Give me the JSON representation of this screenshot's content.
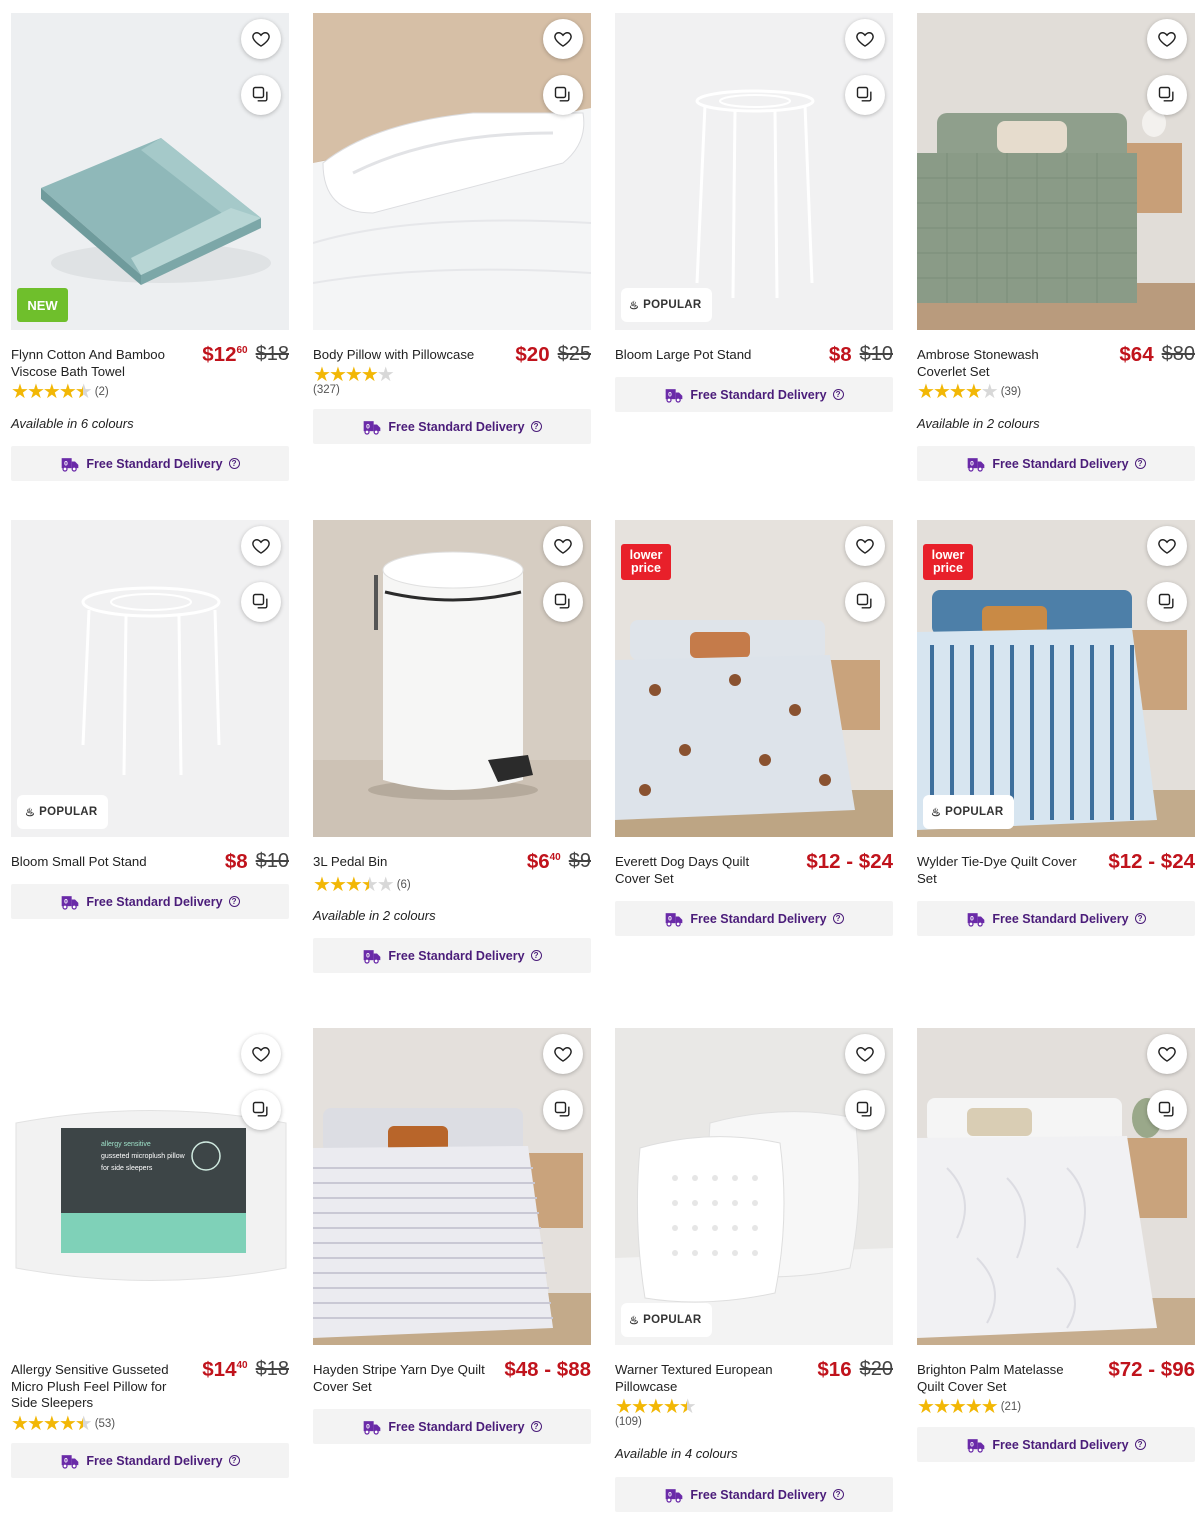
{
  "icons": {
    "wishlist": "heart-outline-icon",
    "compare": "compare-icon",
    "delivery": "truck-icon",
    "help": "question-circle-icon",
    "popular": "flame-icon"
  },
  "colors": {
    "price_red": "#c0131c",
    "delivery_purple": "#4b1d7a",
    "star_gold": "#f2b705",
    "badge_new_green": "#6fbf2c",
    "badge_lower_red": "#e8202a"
  },
  "badges": {
    "new": "NEW",
    "popular": "POPULAR",
    "lower_price": "lower price"
  },
  "delivery_label": "Free Standard Delivery",
  "products": [
    {
      "title": "Flynn Cotton And Bamboo Viscose Bath Towel",
      "price_main": "$12",
      "price_cents": "60",
      "was": "$18",
      "rating": 4.5,
      "reviews": "(2)",
      "colours": "Available in 6 colours",
      "badge": "NEW"
    },
    {
      "title": "Body Pillow with Pillowcase",
      "price_main": "$20",
      "price_cents": "",
      "was": "$25",
      "rating": 4,
      "reviews": "(327)",
      "colours": ""
    },
    {
      "title": "Bloom Large Pot Stand",
      "price_main": "$8",
      "price_cents": "",
      "was": "$10",
      "colours": "",
      "badge": "POPULAR"
    },
    {
      "title": "Ambrose Stonewash Coverlet Set",
      "price_main": "$64",
      "price_cents": "",
      "was": "$80",
      "rating": 4,
      "reviews": "(39)",
      "colours": "Available in 2 colours"
    },
    {
      "title": "Bloom Small Pot Stand",
      "price_main": "$8",
      "price_cents": "",
      "was": "$10",
      "colours": "",
      "badge": "POPULAR"
    },
    {
      "title": "3L Pedal Bin",
      "price_main": "$6",
      "price_cents": "40",
      "was": "$9",
      "rating": 3.5,
      "reviews": "(6)",
      "colours": "Available in 2 colours"
    },
    {
      "title": "Everett Dog Days Quilt Cover Set",
      "price_main": "$12 - $24",
      "price_cents": "",
      "was": "",
      "colours": "",
      "badge": "lower price"
    },
    {
      "title": "Wylder Tie-Dye Quilt Cover Set",
      "price_main": "$12 - $24",
      "price_cents": "",
      "was": "",
      "colours": "",
      "badge": "lower price",
      "badge2": "POPULAR"
    },
    {
      "title": "Allergy Sensitive Gusseted Micro Plush Feel Pillow for Side Sleepers",
      "price_main": "$14",
      "price_cents": "40",
      "was": "$18",
      "rating": 4.5,
      "reviews": "(53)",
      "colours": ""
    },
    {
      "title": "Hayden Stripe Yarn Dye Quilt Cover Set",
      "price_main": "$48 - $88",
      "price_cents": "",
      "was": "",
      "colours": ""
    },
    {
      "title": "Warner Textured European Pillowcase",
      "price_main": "$16",
      "price_cents": "",
      "was": "$20",
      "rating": 4.5,
      "reviews": "(109)",
      "colours": "Available in 4 colours",
      "badge": "POPULAR"
    },
    {
      "title": "Brighton Palm Matelasse Quilt Cover Set",
      "price_main": "$72 - $96",
      "price_cents": "",
      "was": "",
      "rating": 5,
      "reviews": "(21)",
      "colours": ""
    }
  ],
  "pillow_package": {
    "line1": "allergy sensitive",
    "line2": "gusseted microplush pillow",
    "line3": "for side sleepers"
  }
}
